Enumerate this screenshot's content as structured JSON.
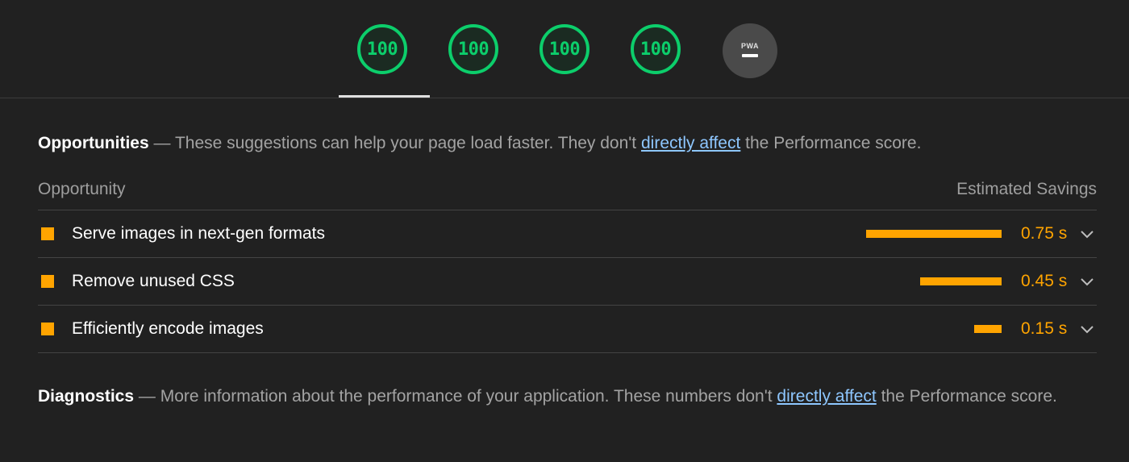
{
  "gauges": [
    {
      "label": "100"
    },
    {
      "label": "100"
    },
    {
      "label": "100"
    },
    {
      "label": "100"
    }
  ],
  "pwa": {
    "label": "PWA"
  },
  "opportunities": {
    "title": "Opportunities",
    "dash": " — ",
    "description": "These suggestions can help your page load faster. They don't ",
    "link": "directly affect",
    "description_end": " the Performance score.",
    "col_left": "Opportunity",
    "col_right": "Estimated Savings",
    "rows": [
      {
        "label": "Serve images in next-gen formats",
        "value": "0.75 s",
        "savings_fraction": 1.0
      },
      {
        "label": "Remove unused CSS",
        "value": "0.45 s",
        "savings_fraction": 0.6
      },
      {
        "label": "Efficiently encode images",
        "value": "0.15 s",
        "savings_fraction": 0.2
      }
    ]
  },
  "diagnostics": {
    "title": "Diagnostics",
    "dash": " — ",
    "description": "More information about the performance of your application. These numbers don't ",
    "link": "directly affect",
    "description_end": " the Performance score."
  },
  "colors": {
    "pass": "#0cce6b",
    "average": "#ffa400",
    "link": "#8ec7ff",
    "background": "#212121"
  }
}
